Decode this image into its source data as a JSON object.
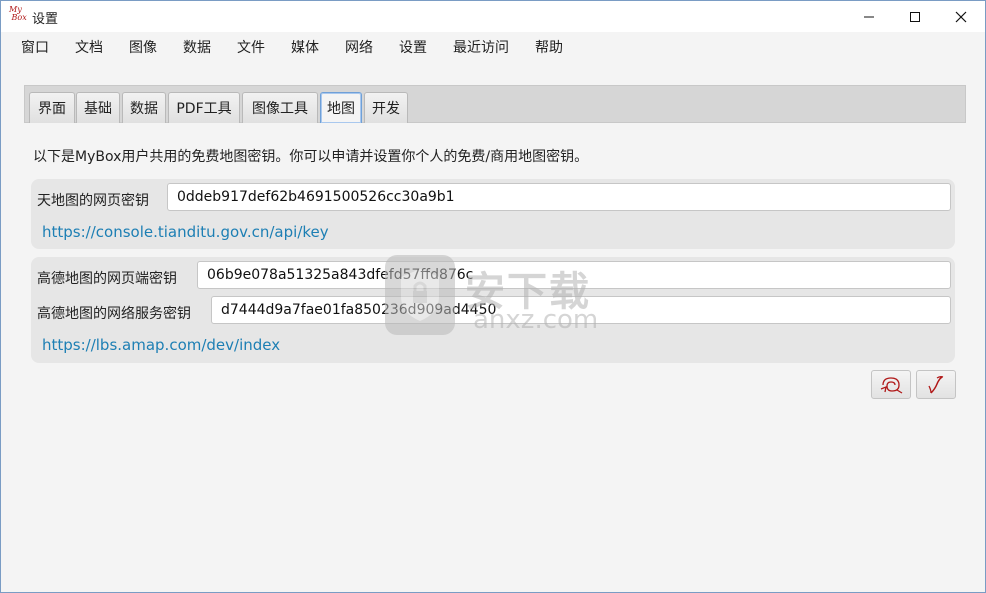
{
  "window": {
    "title": "设置",
    "app_icon_text": "My Box"
  },
  "menu": [
    "窗口",
    "文档",
    "图像",
    "数据",
    "文件",
    "媒体",
    "网络",
    "设置",
    "最近访问",
    "帮助"
  ],
  "tabs": [
    {
      "label": "界面",
      "active": false
    },
    {
      "label": "基础",
      "active": false
    },
    {
      "label": "数据",
      "active": false
    },
    {
      "label": "PDF工具",
      "active": false
    },
    {
      "label": "图像工具",
      "active": false
    },
    {
      "label": "地图",
      "active": true
    },
    {
      "label": "开发",
      "active": false
    }
  ],
  "description": "以下是MyBox用户共用的免费地图密钥。你可以申请并设置你个人的免费/商用地图密钥。",
  "tianditu": {
    "label": "天地图的网页密钥",
    "value": "0ddeb917def62b4691500526cc30a9b1",
    "link": "https://console.tianditu.gov.cn/api/key"
  },
  "gaode": {
    "web_label": "高德地图的网页端密钥",
    "web_value": "06b9e078a51325a843dfefd57ffd876c",
    "service_label": "高德地图的网络服务密钥",
    "service_value": "d7444d9a7fae01fa850236d909ad4450",
    "link": "https://lbs.amap.com/dev/index"
  },
  "watermark": {
    "title": "安下载",
    "sub": "anxz.com"
  },
  "buttons": {
    "recover_icon": "recover-icon",
    "ok_icon": "ok-icon"
  },
  "colors": {
    "link": "#1d7fb4",
    "icon_red": "#b01818",
    "active_tab_border": "#6fa0d8"
  }
}
